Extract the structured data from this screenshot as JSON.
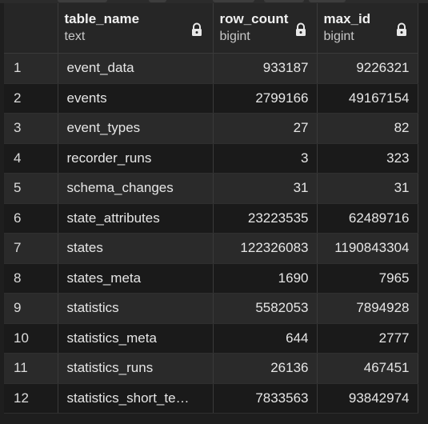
{
  "columns": [
    {
      "name": "table_name",
      "type": "text"
    },
    {
      "name": "row_count",
      "type": "bigint"
    },
    {
      "name": "max_id",
      "type": "bigint"
    }
  ],
  "rows": [
    {
      "num": "1",
      "table_name": "event_data",
      "row_count": "933187",
      "max_id": "9226321"
    },
    {
      "num": "2",
      "table_name": "events",
      "row_count": "2799166",
      "max_id": "49167154"
    },
    {
      "num": "3",
      "table_name": "event_types",
      "row_count": "27",
      "max_id": "82"
    },
    {
      "num": "4",
      "table_name": "recorder_runs",
      "row_count": "3",
      "max_id": "323"
    },
    {
      "num": "5",
      "table_name": "schema_changes",
      "row_count": "31",
      "max_id": "31"
    },
    {
      "num": "6",
      "table_name": "state_attributes",
      "row_count": "23223535",
      "max_id": "62489716"
    },
    {
      "num": "7",
      "table_name": "states",
      "row_count": "122326083",
      "max_id": "1190843304"
    },
    {
      "num": "8",
      "table_name": "states_meta",
      "row_count": "1690",
      "max_id": "7965"
    },
    {
      "num": "9",
      "table_name": "statistics",
      "row_count": "5582053",
      "max_id": "7894928"
    },
    {
      "num": "10",
      "table_name": "statistics_meta",
      "row_count": "644",
      "max_id": "2777"
    },
    {
      "num": "11",
      "table_name": "statistics_runs",
      "row_count": "26136",
      "max_id": "467451"
    },
    {
      "num": "12",
      "table_name": "statistics_short_te…",
      "row_count": "7833563",
      "max_id": "93842974"
    }
  ],
  "icons": {
    "column_lock": "lock-icon"
  },
  "colors": {
    "background": "#1e1e1e",
    "header": "#262626",
    "row_odd": "#2a2a2a",
    "row_even": "#1a1a1a",
    "grid": "#3a3a3a"
  }
}
